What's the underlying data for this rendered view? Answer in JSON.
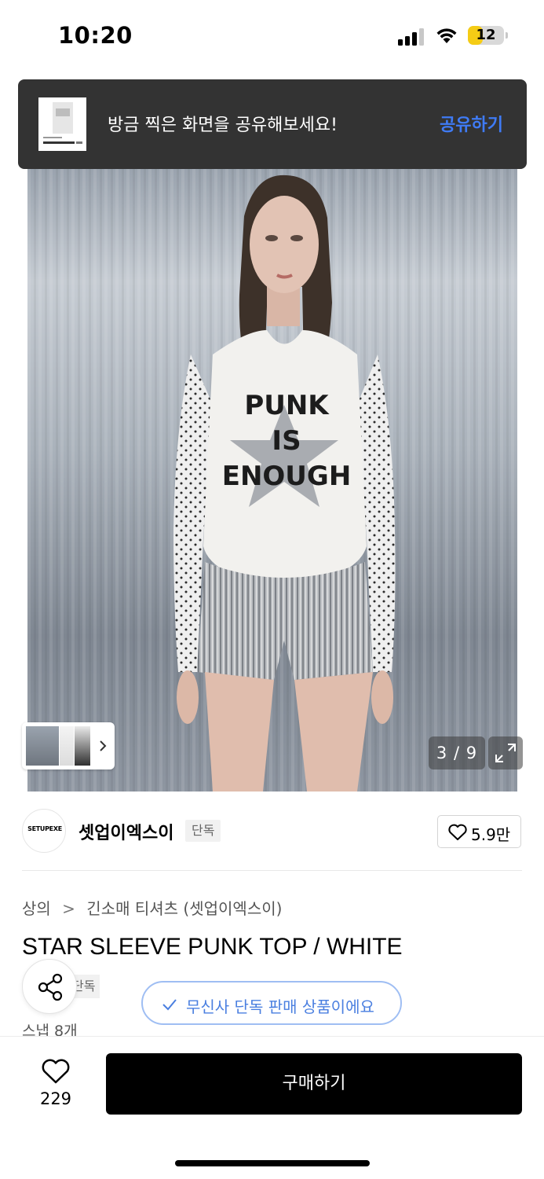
{
  "status_bar": {
    "time": "10:20",
    "battery": "12",
    "battery_level": 0.42
  },
  "toast": {
    "message": "방금 찍은 화면을 공유해보세요!",
    "action": "공유하기"
  },
  "gallery": {
    "counter": "3 / 9",
    "shirt_text": [
      "PUNK",
      "IS",
      "ENOUGH"
    ]
  },
  "brand": {
    "logo_text": "SETUPEXE",
    "name": "셋업이엑스이",
    "badge": "단독",
    "like_count": "5.9만"
  },
  "product": {
    "breadcrumb": [
      "상의",
      "긴소매 티셔츠 (셋업이엑스이)"
    ],
    "breadcrumb_separator": ">",
    "title": "STAR SLEEVE PUNK TOP / WHITE",
    "exclusive_badge": "단독",
    "snap_count": "스냅 8개",
    "exclusive_notice": "무신사 단독 판매 상품이에요"
  },
  "bottom_bar": {
    "wishlist_count": "229",
    "buy_label": "구매하기"
  },
  "colors": {
    "accent": "#3f7bf5",
    "toast_bg": "#333333",
    "buy_bg": "#000000",
    "pill_border": "#9fbef3"
  },
  "icons": [
    "signal-icon",
    "wifi-icon",
    "battery-icon",
    "expand-icon",
    "chevron-right-icon",
    "heart-icon",
    "share-icon",
    "check-icon"
  ]
}
